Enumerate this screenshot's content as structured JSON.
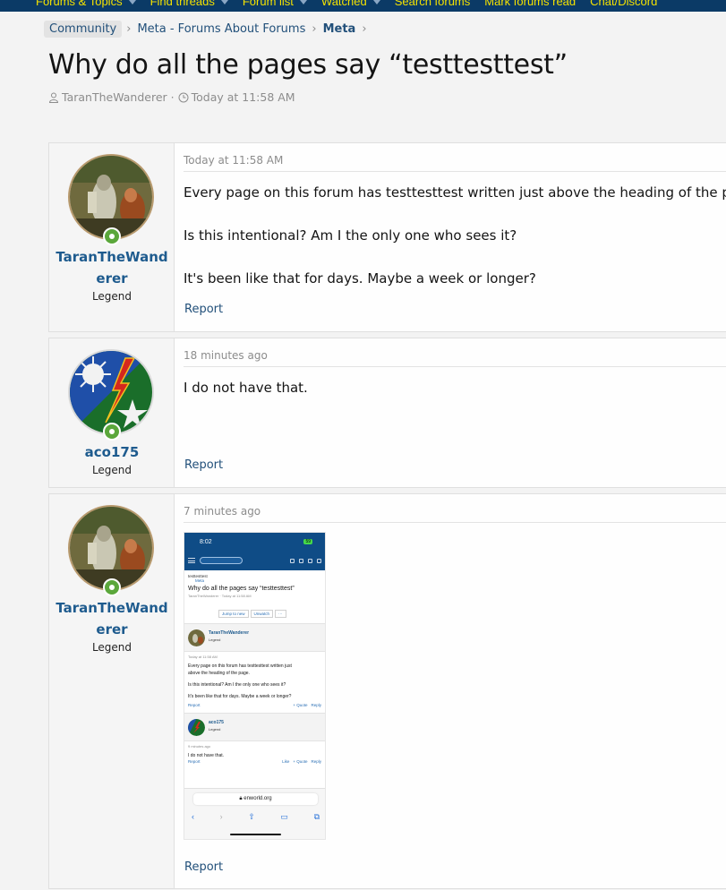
{
  "nav": {
    "items": [
      "Forums & Topics",
      "Find threads",
      "Forum list",
      "Watched",
      "Search forums",
      "Mark forums read",
      "Chat/Discord"
    ]
  },
  "breadcrumb": {
    "items": [
      "Community",
      "Meta - Forums About Forums",
      "Meta"
    ]
  },
  "thread": {
    "title": "Why do all the pages say “testtesttest”",
    "author": "TaranTheWanderer",
    "date": "Today at 11:58 AM"
  },
  "posts": [
    {
      "username_line1": "TaranTheWand",
      "username_line2": "erer",
      "user_title": "Legend",
      "date": "Today at 11:58 AM",
      "paragraphs": [
        "Every page on this forum has testtesttest written just above the heading of the page.",
        "Is this intentional? Am I the only one who sees it?",
        "It's been like that for days. Maybe a week or longer?"
      ],
      "report": "Report"
    },
    {
      "username": "aco175",
      "user_title": "Legend",
      "date": "18 minutes ago",
      "paragraphs": [
        "I do not have that."
      ],
      "report": "Report"
    },
    {
      "username_line1": "TaranTheWand",
      "username_line2": "erer",
      "user_title": "Legend",
      "date": "7 minutes ago",
      "report": "Report",
      "screenshot": {
        "time": "8:02",
        "battery": "59",
        "breadcrumb1": "testtesttest",
        "breadcrumb2": "Meta",
        "title": "Why do all the pages say “testtesttest”",
        "meta": "TaranTheWanderer · Today at 11:58 AM",
        "jump": "Jump to new",
        "unwatch": "Unwatch",
        "more": "···",
        "user1": "TaranTheWanderer",
        "user1_title": "Legend",
        "post1_date": "Today at 11:58 AM",
        "post1_lines": [
          "Every page on this forum has testtesttest written just",
          "above the heading of the page.",
          "Is this intentional? Am I the only one who sees it?",
          "It's been like that for days. Maybe a week or longer?"
        ],
        "report": "Report",
        "quote": "+ Quote",
        "reply": "Reply",
        "user2": "aco175",
        "user2_title": "Legend",
        "post2_date": "9 minutes ago",
        "post2_text": "I do not have that.",
        "like": "Like",
        "url": "enworld.org"
      }
    }
  ]
}
